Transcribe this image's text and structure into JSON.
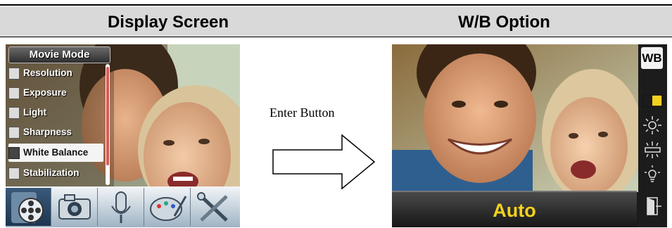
{
  "header": {
    "left_title": "Display Screen",
    "right_title": "W/B Option"
  },
  "left_screen": {
    "menu_title": "Movie Mode",
    "menu_items": [
      {
        "label": "Resolution",
        "icon": "resolution-icon",
        "selected": false
      },
      {
        "label": "Exposure",
        "icon": "exposure-icon",
        "selected": false
      },
      {
        "label": "Light",
        "icon": "light-icon",
        "selected": false
      },
      {
        "label": "Sharpness",
        "icon": "sharpness-icon",
        "selected": false
      },
      {
        "label": "White Balance",
        "icon": "white-balance-icon",
        "selected": true
      },
      {
        "label": "Stabilization",
        "icon": "stabilization-icon",
        "selected": false
      }
    ],
    "tabs": [
      {
        "icon": "film-reel-icon",
        "active": true
      },
      {
        "icon": "camera-icon",
        "active": false
      },
      {
        "icon": "microphone-icon",
        "active": false
      },
      {
        "icon": "palette-icon",
        "active": false
      },
      {
        "icon": "tools-icon",
        "active": false
      }
    ],
    "colors": {
      "selected_bg": "#f4f4f4",
      "scroll_thumb": "#d85a58",
      "active_tab": "#1d3550"
    }
  },
  "transition": {
    "label": "Enter Button",
    "icon": "right-arrow-icon"
  },
  "right_screen": {
    "badge": "WB",
    "status_value": "Auto",
    "side_icons": [
      {
        "icon": "auto-wb-icon",
        "selected": true
      },
      {
        "icon": "daylight-icon",
        "selected": false
      },
      {
        "icon": "fluorescent-icon",
        "selected": false
      },
      {
        "icon": "tungsten-icon",
        "selected": false
      },
      {
        "icon": "exit-icon",
        "selected": false
      }
    ],
    "colors": {
      "status_text": "#f2d21e",
      "selected_icon": "#f2d21e"
    }
  }
}
